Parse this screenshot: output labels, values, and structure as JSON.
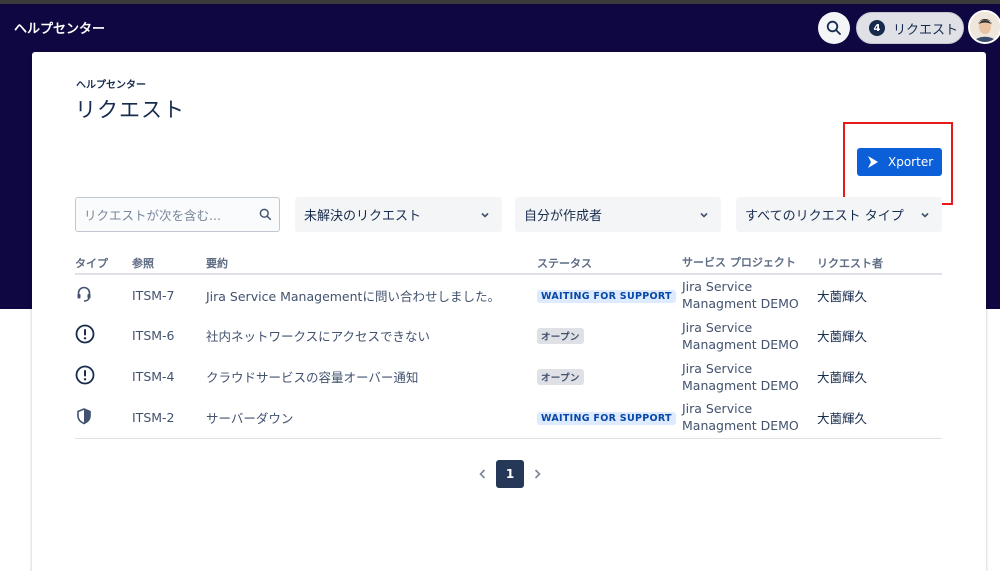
{
  "header": {
    "brand": "ヘルプセンター",
    "requests_label": "リクエスト",
    "requests_count": "4"
  },
  "page": {
    "breadcrumb": "ヘルプセンター",
    "title": "リクエスト"
  },
  "xporter": {
    "label": "Xporter"
  },
  "filters": {
    "search_placeholder": "リクエストが次を含む...",
    "status": "未解決のリクエスト",
    "creator": "自分が作成者",
    "type": "すべてのリクエスト タイプ"
  },
  "table": {
    "headers": [
      "タイプ",
      "参照",
      "要約",
      "ステータス",
      "サービス プロジェクト",
      "リクエスト者"
    ],
    "rows": [
      {
        "icon": "headset-icon",
        "ref": "ITSM-7",
        "summary": "Jira Service Managementに問い合わせしました。",
        "status": "WAITING FOR SUPPORT",
        "project_line1": "Jira Service",
        "project_line2": "Managment DEMO",
        "requester": "大薗輝久"
      },
      {
        "icon": "alert-circle-icon",
        "ref": "ITSM-6",
        "summary": "社内ネットワークスにアクセスできない",
        "status": "オープン",
        "project_line1": "Jira Service",
        "project_line2": "Managment DEMO",
        "requester": "大薗輝久"
      },
      {
        "icon": "alert-circle-icon",
        "ref": "ITSM-4",
        "summary": "クラウドサービスの容量オーバー通知",
        "status": "オープン",
        "project_line1": "Jira Service",
        "project_line2": "Managment DEMO",
        "requester": "大薗輝久"
      },
      {
        "icon": "shield-icon",
        "ref": "ITSM-2",
        "summary": "サーバーダウン",
        "status": "WAITING FOR SUPPORT",
        "project_line1": "Jira Service",
        "project_line2": "Managment DEMO",
        "requester": "大薗輝久"
      }
    ]
  },
  "pagination": {
    "current": "1"
  },
  "colors": {
    "header_bg": "#0f0742",
    "xporter_button": "#0b5fd8",
    "highlight_frame": "#e8191b",
    "status_waiting_bg": "#deebff",
    "status_open_bg": "#dfe1e6",
    "page_active": "#253858"
  }
}
